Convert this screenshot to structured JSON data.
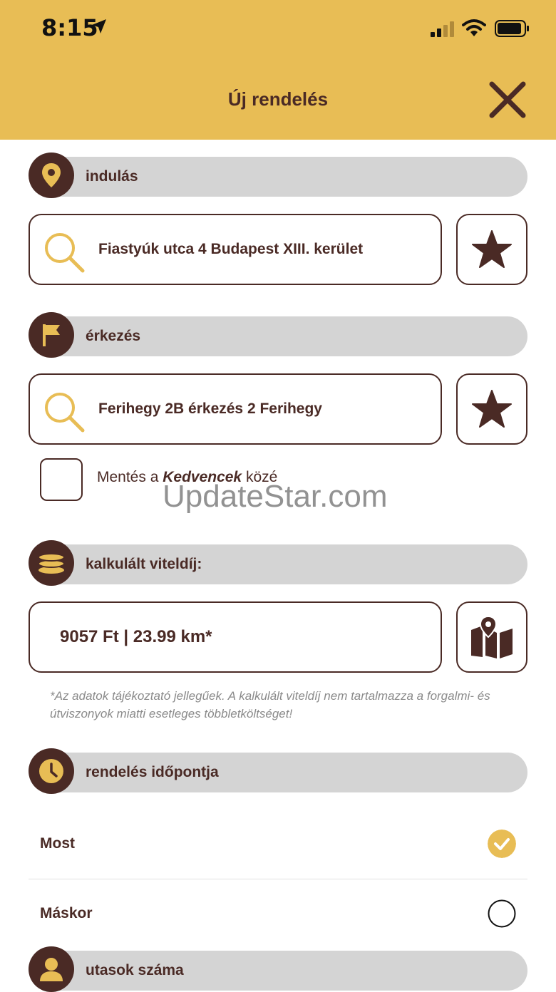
{
  "status_bar": {
    "time": "8:15"
  },
  "header": {
    "title": "Új rendelés"
  },
  "departure": {
    "section_label": "indulás",
    "value": "Fiastyúk utca 4 Budapest XIII. kerület"
  },
  "arrival": {
    "section_label": "érkezés",
    "value": "Ferihegy 2B érkezés 2 Ferihegy"
  },
  "favorites": {
    "prefix": "Mentés a ",
    "emphasis": "Kedvencek",
    "suffix": " közé",
    "checked": false
  },
  "watermark": "UpdateStar.com",
  "fare": {
    "section_label": "kalkulált viteldíj:",
    "value": "9057 Ft | 23.99 km*",
    "note": "*Az adatok tájékoztató jellegűek. A kalkulált viteldíj nem tartalmazza a forgalmi- és útviszonyok miatti esetleges többletköltséget!"
  },
  "order_time": {
    "section_label": "rendelés időpontja",
    "options": [
      {
        "label": "Most",
        "selected": true
      },
      {
        "label": "Máskor",
        "selected": false
      }
    ]
  },
  "passengers": {
    "section_label": "utasok száma"
  },
  "icons": {
    "departure": "location-pin-icon",
    "arrival": "flag-icon",
    "fare": "coins-icon",
    "order_time": "clock-icon",
    "passengers": "person-icon",
    "search": "search-icon",
    "favorite": "star-icon",
    "map": "map-icon",
    "close": "close-icon"
  },
  "colors": {
    "accent": "#e8bd55",
    "dark": "#4a2a25",
    "bar": "#d4d4d4"
  }
}
